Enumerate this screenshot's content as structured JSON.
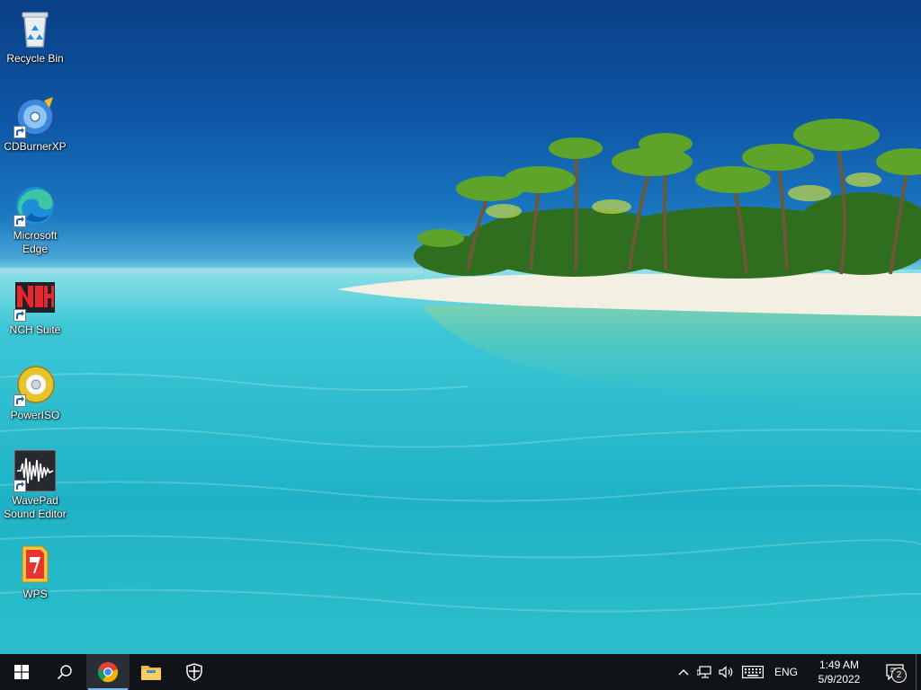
{
  "desktop_icons": [
    {
      "label": "Recycle Bin",
      "icon": "recycle-bin-icon"
    },
    {
      "label": "CDBurnerXP",
      "icon": "cdburnerxp-icon"
    },
    {
      "label": "Microsoft Edge",
      "icon": "edge-icon"
    },
    {
      "label": "NCH Suite",
      "icon": "nch-icon"
    },
    {
      "label": "PowerISO",
      "icon": "poweriso-icon"
    },
    {
      "label": "WavePad Sound Editor",
      "icon": "wavepad-icon"
    },
    {
      "label": "WPS",
      "icon": "wps-icon"
    }
  ],
  "taskbar": {
    "start": "windows-start-icon",
    "search": "search-icon",
    "pinned": [
      "chrome-icon",
      "file-explorer-icon",
      "windows-security-icon"
    ],
    "active_app": "chrome-icon"
  },
  "tray": {
    "language": "ENG",
    "time": "1:49 AM",
    "date": "5/9/2022",
    "notification_count": "2"
  },
  "colors": {
    "taskbar_bg": "#101418",
    "accent": "#76b9ed",
    "sky": "#0e57a6",
    "sea": "#20b6cb"
  }
}
